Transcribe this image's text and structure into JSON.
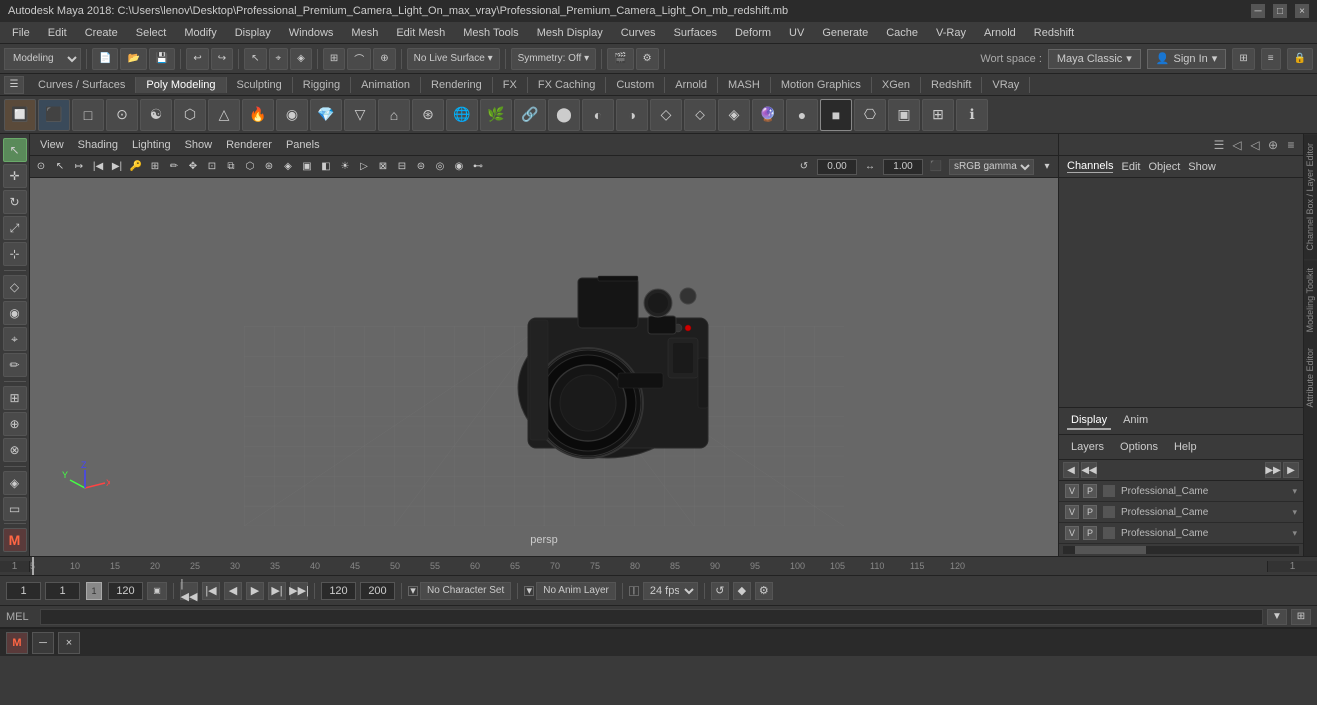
{
  "title_bar": {
    "title": "Autodesk Maya 2018: C:\\Users\\lenov\\Desktop\\Professional_Premium_Camera_Light_On_max_vray\\Professional_Premium_Camera_Light_On_mb_redshift.mb"
  },
  "menu_bar": {
    "items": [
      "File",
      "Edit",
      "Create",
      "Select",
      "Modify",
      "Display",
      "Windows",
      "Mesh",
      "Edit Mesh",
      "Mesh Tools",
      "Mesh Display",
      "Curves",
      "Surfaces",
      "Deform",
      "UV",
      "Generate",
      "Cache",
      "V-Ray",
      "Arnold",
      "Redshift"
    ]
  },
  "toolbar1": {
    "mode_label": "Modeling",
    "workspace_label": "Wort space :",
    "workspace_value": "Maya Classic",
    "sign_in_label": "Sign In"
  },
  "shelf_tabs": {
    "items": [
      "Curves / Surfaces",
      "Poly Modeling",
      "Sculpting",
      "Rigging",
      "Animation",
      "Rendering",
      "FX",
      "FX Caching",
      "Custom",
      "Arnold",
      "MASH",
      "Motion Graphics",
      "XGen",
      "Redshift",
      "VRay"
    ]
  },
  "viewport_menu": {
    "items": [
      "View",
      "Shading",
      "Lighting",
      "Show",
      "Renderer",
      "Panels"
    ]
  },
  "viewport": {
    "persp_label": "persp",
    "gamma_label": "sRGB gamma",
    "gamma_value": "0.00",
    "gamma_value2": "1.00"
  },
  "right_panel": {
    "tabs": [
      "Channels",
      "Edit",
      "Object",
      "Show"
    ],
    "bottom_tabs": [
      "Display",
      "Anim"
    ],
    "layer_tabs": [
      "Layers",
      "Options",
      "Help"
    ],
    "layers": [
      {
        "v": "V",
        "p": "P",
        "name": "Professional_Came"
      },
      {
        "v": "V",
        "p": "P",
        "name": "Professional_Came"
      },
      {
        "v": "V",
        "p": "P",
        "name": "Professional_Came"
      }
    ],
    "channel_box_tab": "Channel Box",
    "layer_editor_tab": "Layer Editor",
    "modeling_toolkit_tab": "Modeling Toolkit",
    "attribute_editor_tab": "Attribute Editor"
  },
  "playback": {
    "start_frame": "1",
    "current_frame": "1",
    "playback_range": "1",
    "end_range": "120",
    "end_frame_field": "120",
    "max_frame": "200",
    "char_set_label": "No Character Set",
    "anim_layer_label": "No Anim Layer",
    "fps_label": "24 fps"
  },
  "mel_bar": {
    "label": "MEL",
    "placeholder": ""
  },
  "bottom_taskbar": {
    "maya_icon": "M",
    "close_icon": "×"
  },
  "icons": {
    "select": "↖",
    "move": "✛",
    "rotate": "↻",
    "scale": "⤢",
    "snap": "⊹",
    "lasso": "⌖",
    "paint": "✏",
    "rectangle": "▭"
  }
}
